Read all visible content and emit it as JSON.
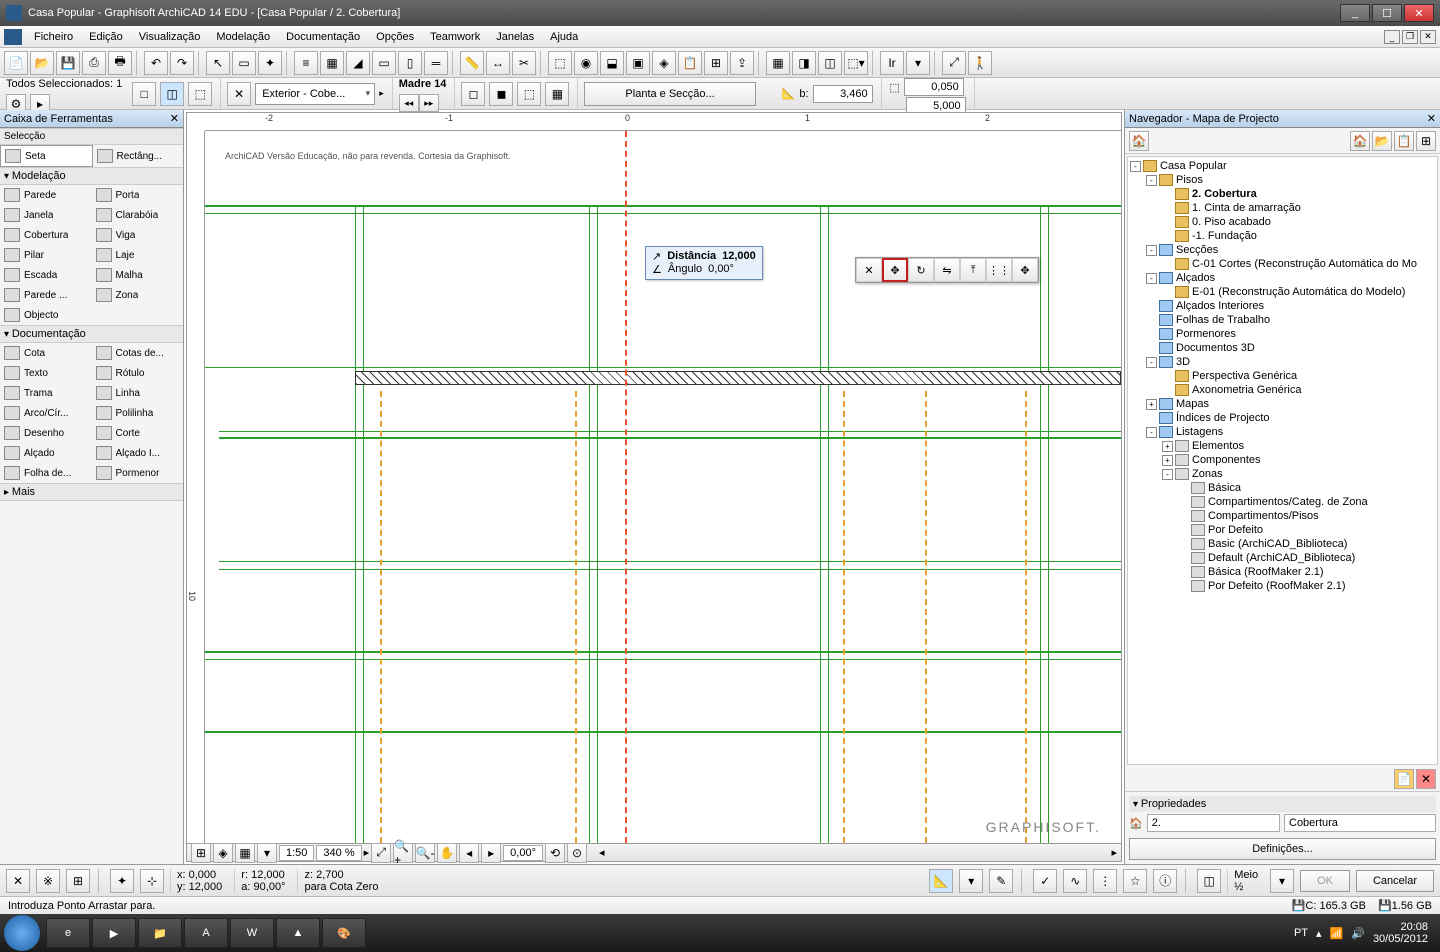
{
  "title": "Casa Popular - Graphisoft ArchiCAD 14 EDU - [Casa Popular / 2. Cobertura]",
  "menu": [
    "Ficheiro",
    "Edição",
    "Visualização",
    "Modelação",
    "Documentação",
    "Opções",
    "Teamwork",
    "Janelas",
    "Ajuda"
  ],
  "infobar": {
    "sel_label": "Todos Seleccionados: 1",
    "view_combo": "Exterior - Cobe...",
    "layer_name": "Madre 14",
    "main_button": "Planta e Secção...",
    "dim_b_label": "b:",
    "dim_b_value": "3,460",
    "dim_w_value": "0,050",
    "dim_h_value": "5,000"
  },
  "toolbox": {
    "title": "Caixa de Ferramentas",
    "selection_hdr": "Selecção",
    "selection": [
      [
        "Seta",
        "Rectâng..."
      ]
    ],
    "model_hdr": "Modelação",
    "model": [
      [
        "Parede",
        "Porta"
      ],
      [
        "Janela",
        "Clarabóia"
      ],
      [
        "Cobertura",
        "Viga"
      ],
      [
        "Pilar",
        "Laje"
      ],
      [
        "Escada",
        "Malha"
      ],
      [
        "Parede ...",
        "Zona"
      ],
      [
        "Objecto",
        ""
      ]
    ],
    "doc_hdr": "Documentação",
    "doc": [
      [
        "Cota",
        "Cotas de..."
      ],
      [
        "Texto",
        "Rótulo"
      ],
      [
        "Trama",
        "Linha"
      ],
      [
        "Arco/Cír...",
        "Polilinha"
      ],
      [
        "Desenho",
        "Corte"
      ],
      [
        "Alçado",
        "Alçado I..."
      ],
      [
        "Folha de...",
        "Pormenor"
      ]
    ],
    "more": "Mais"
  },
  "canvas": {
    "watermark": "ArchiCAD Versão Educação, não para revenda. Cortesia da Graphisoft.",
    "brand": "GRAPHISOFT.",
    "tracker_dist_label": "Distância",
    "tracker_dist_value": "12,000",
    "tracker_ang_label": "Ângulo",
    "tracker_ang_value": "0,00°",
    "ruler_h": [
      "-2",
      "-1",
      "0",
      "1",
      "2"
    ],
    "ruler_v": [
      "10"
    ],
    "scale": "1:50",
    "zoom": "340 %",
    "angle_disp": "0,00°"
  },
  "navigator": {
    "title": "Navegador - Mapa de Projecto",
    "tree": [
      {
        "d": 0,
        "e": "-",
        "i": "orange",
        "t": "Casa Popular"
      },
      {
        "d": 1,
        "e": "-",
        "i": "orange",
        "t": "Pisos"
      },
      {
        "d": 2,
        "e": "",
        "i": "orange",
        "t": "2. Cobertura",
        "b": true
      },
      {
        "d": 2,
        "e": "",
        "i": "orange",
        "t": "1. Cinta de amarração"
      },
      {
        "d": 2,
        "e": "",
        "i": "orange",
        "t": "0. Piso acabado"
      },
      {
        "d": 2,
        "e": "",
        "i": "orange",
        "t": "-1. Fundação"
      },
      {
        "d": 1,
        "e": "-",
        "i": "blue",
        "t": "Secções"
      },
      {
        "d": 2,
        "e": "",
        "i": "orange",
        "t": "C-01 Cortes (Reconstrução Automática do Mo"
      },
      {
        "d": 1,
        "e": "-",
        "i": "blue",
        "t": "Alçados"
      },
      {
        "d": 2,
        "e": "",
        "i": "orange",
        "t": "E-01 (Reconstrução Automática do Modelo)"
      },
      {
        "d": 1,
        "e": "",
        "i": "blue",
        "t": "Alçados Interiores"
      },
      {
        "d": 1,
        "e": "",
        "i": "blue",
        "t": "Folhas de Trabalho"
      },
      {
        "d": 1,
        "e": "",
        "i": "blue",
        "t": "Pormenores"
      },
      {
        "d": 1,
        "e": "",
        "i": "blue",
        "t": "Documentos 3D"
      },
      {
        "d": 1,
        "e": "-",
        "i": "blue",
        "t": "3D"
      },
      {
        "d": 2,
        "e": "",
        "i": "orange",
        "t": "Perspectiva Genérica"
      },
      {
        "d": 2,
        "e": "",
        "i": "orange",
        "t": "Axonometria Genérica"
      },
      {
        "d": 1,
        "e": "+",
        "i": "blue",
        "t": "Mapas"
      },
      {
        "d": 1,
        "e": "",
        "i": "blue",
        "t": "Índices de Projecto"
      },
      {
        "d": 1,
        "e": "-",
        "i": "blue",
        "t": "Listagens"
      },
      {
        "d": 2,
        "e": "+",
        "i": "gray",
        "t": "Elementos"
      },
      {
        "d": 2,
        "e": "+",
        "i": "gray",
        "t": "Componentes"
      },
      {
        "d": 2,
        "e": "-",
        "i": "gray",
        "t": "Zonas"
      },
      {
        "d": 3,
        "e": "",
        "i": "gray",
        "t": "Básica"
      },
      {
        "d": 3,
        "e": "",
        "i": "gray",
        "t": "Compartimentos/Categ. de Zona"
      },
      {
        "d": 3,
        "e": "",
        "i": "gray",
        "t": "Compartimentos/Pisos"
      },
      {
        "d": 3,
        "e": "",
        "i": "gray",
        "t": "Por Defeito"
      },
      {
        "d": 3,
        "e": "",
        "i": "gray",
        "t": "Basic (ArchiCAD_Biblioteca)"
      },
      {
        "d": 3,
        "e": "",
        "i": "gray",
        "t": "Default (ArchiCAD_Biblioteca)"
      },
      {
        "d": 3,
        "e": "",
        "i": "gray",
        "t": "Básica (RoofMaker 2.1)"
      },
      {
        "d": 3,
        "e": "",
        "i": "gray",
        "t": "Por Defeito (RoofMaker 2.1)"
      }
    ],
    "props_hdr": "Propriedades",
    "props_num": "2.",
    "props_name": "Cobertura",
    "defs_button": "Definições..."
  },
  "bottom": {
    "x_label": "x:",
    "x": "0,000",
    "y_label": "y:",
    "y": "12,000",
    "r_label": "r:",
    "r": "12,000",
    "a_label": "a:",
    "a": "90,00°",
    "z_label": "z:",
    "z": "2,700",
    "zero_label": "para Cota Zero",
    "half_label": "Meio",
    "half_val": "½",
    "ok": "OK",
    "cancel": "Cancelar"
  },
  "status": {
    "hint": "Introduza Ponto Arrastar para.",
    "disk_c": "C: 165.3 GB",
    "disk_other": "1.56 GB"
  },
  "taskbar": {
    "lang": "PT",
    "time": "20:08",
    "date": "30/05/2012"
  }
}
